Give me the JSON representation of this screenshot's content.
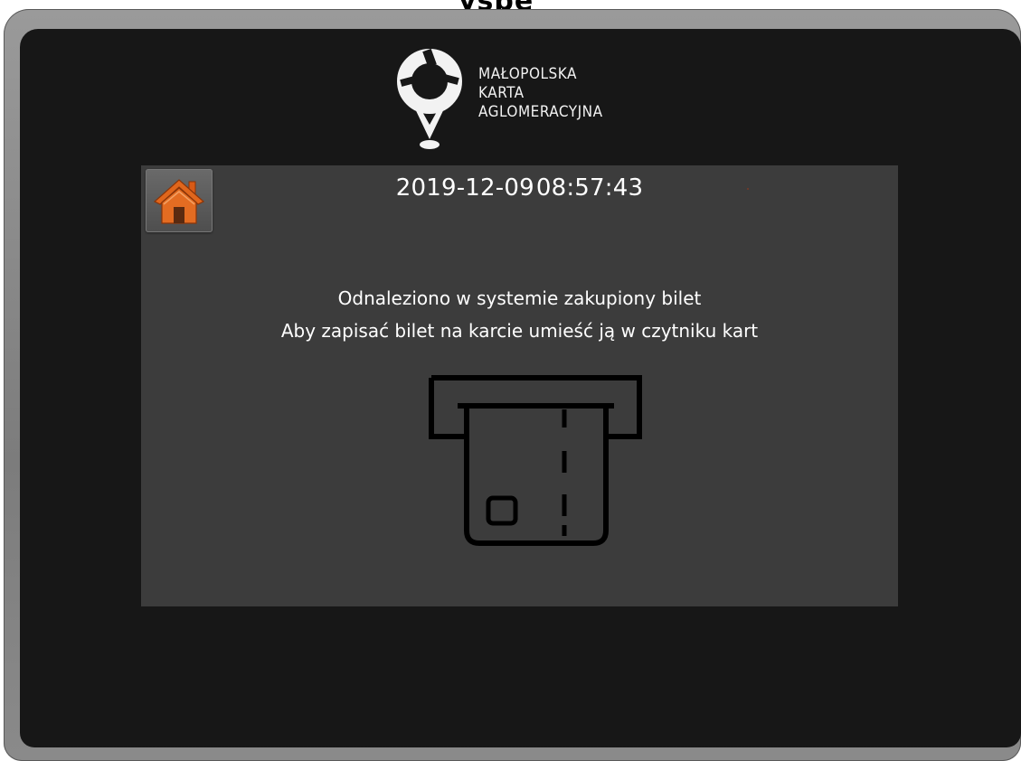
{
  "top_heading_fragment": "yspe",
  "logo": {
    "line1": "MAŁOPOLSKA",
    "line2": "KARTA",
    "line3": "AGLOMERACYJNA",
    "icon": "map-pin-logo-icon"
  },
  "header": {
    "date": "2019-12-09",
    "time": "08:57:43"
  },
  "home_button": {
    "icon": "home-icon",
    "color": "#e0661c"
  },
  "message": {
    "line1": "Odnaleziono w systemie zakupiony bilet",
    "line2": "Aby zapisać bilet na karcie umieść ją w czytniku kart"
  },
  "card_reader": {
    "icon": "card-reader-icon"
  },
  "colors": {
    "screen_background": "#171717",
    "panel_background": "#3c3c3c",
    "text": "#ffffff",
    "accent": "#e0661c"
  }
}
